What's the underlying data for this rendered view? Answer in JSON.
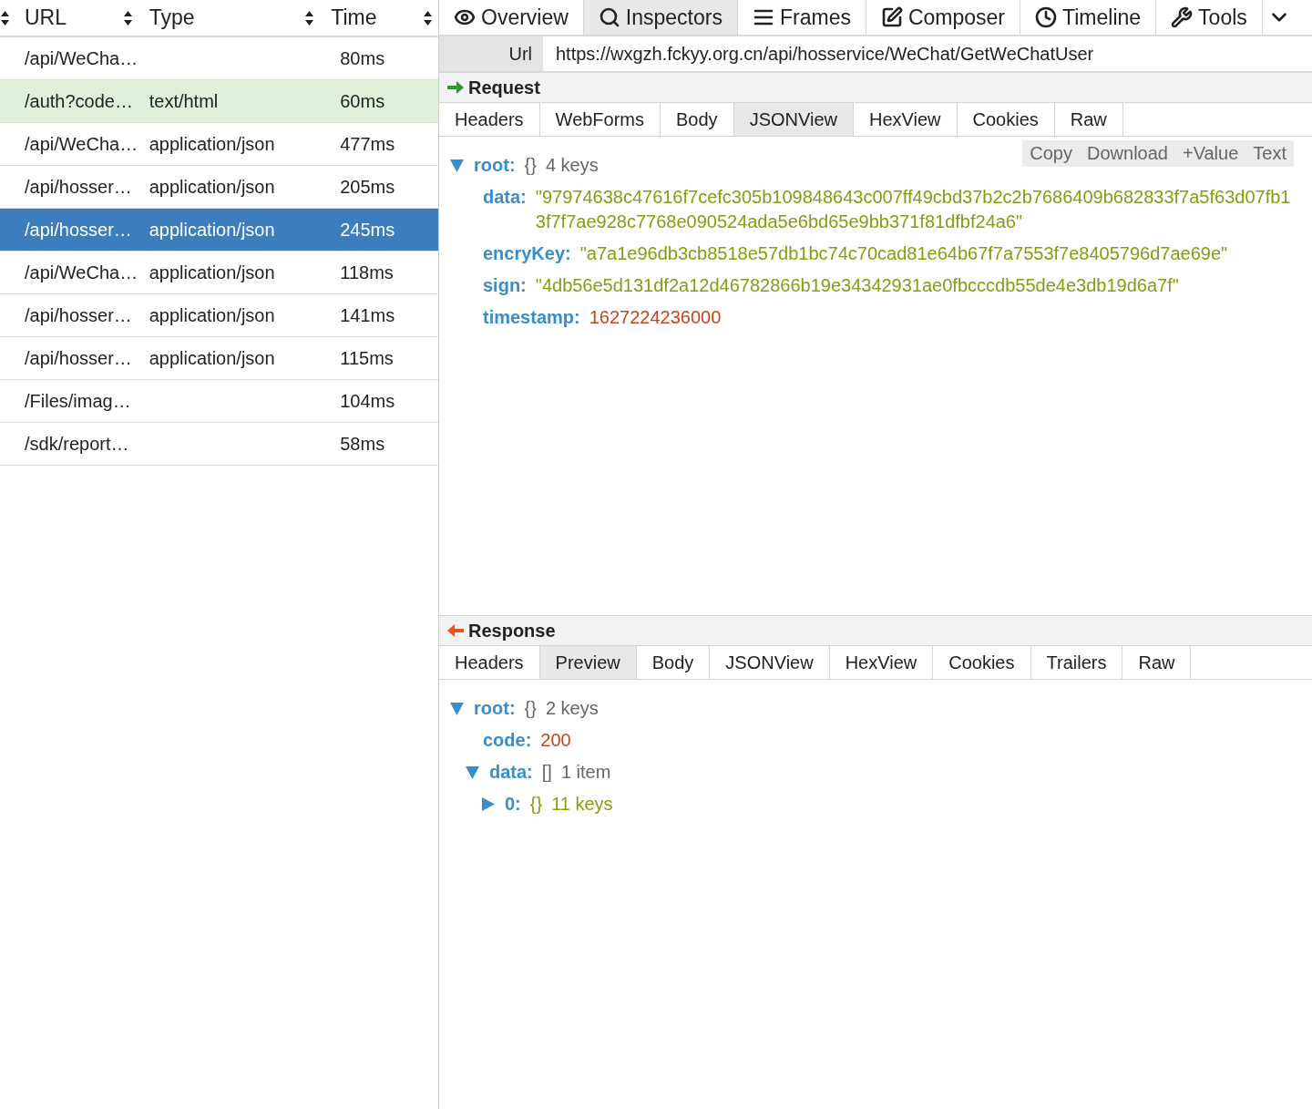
{
  "request_list": {
    "columns": [
      {
        "label": "URL"
      },
      {
        "label": "Type"
      },
      {
        "label": "Time"
      }
    ],
    "rows": [
      {
        "url": "/api/WeCha…",
        "time": "80ms",
        "selected": false,
        "highlighted": false
      },
      {
        "url": "/auth?code…",
        "type": "text/html",
        "time": "60ms",
        "selected": false,
        "highlighted": true
      },
      {
        "url": "/api/WeCha…",
        "type": "application/json",
        "time": "477ms",
        "selected": false,
        "highlighted": false
      },
      {
        "url": "/api/hosser…",
        "type": "application/json",
        "time": "205ms",
        "selected": false,
        "highlighted": false
      },
      {
        "url": "/api/hosser…",
        "type": "application/json",
        "time": "245ms",
        "selected": true,
        "highlighted": false
      },
      {
        "url": "/api/WeCha…",
        "type": "application/json",
        "time": "118ms",
        "selected": false,
        "highlighted": false
      },
      {
        "url": "/api/hosser…",
        "type": "application/json",
        "time": "141ms",
        "selected": false,
        "highlighted": false
      },
      {
        "url": "/api/hosser…",
        "type": "application/json",
        "time": "115ms",
        "selected": false,
        "highlighted": false
      },
      {
        "url": "/Files/imag…",
        "time": "104ms",
        "selected": false,
        "highlighted": false
      },
      {
        "url": "/sdk/report…",
        "time": "58ms",
        "selected": false,
        "highlighted": false
      }
    ]
  },
  "tool_tabs": [
    {
      "label": "Overview",
      "selected": false
    },
    {
      "label": "Inspectors",
      "selected": true
    },
    {
      "label": "Frames",
      "selected": false
    },
    {
      "label": "Composer",
      "selected": false
    },
    {
      "label": "Timeline",
      "selected": false
    },
    {
      "label": "Tools",
      "selected": false
    }
  ],
  "url_bar": {
    "label": "Url",
    "value": "https://wxgzh.fckyy.org.cn/api/hosservice/WeChat/GetWeChatUser"
  },
  "request": {
    "title": "Request",
    "tabs": [
      {
        "label": "Headers",
        "selected": false
      },
      {
        "label": "WebForms",
        "selected": false
      },
      {
        "label": "Body",
        "selected": false
      },
      {
        "label": "JSONView",
        "selected": true
      },
      {
        "label": "HexView",
        "selected": false
      },
      {
        "label": "Cookies",
        "selected": false
      },
      {
        "label": "Raw",
        "selected": false
      }
    ],
    "actions": [
      "Copy",
      "Download",
      "+Value",
      "Text"
    ],
    "tree": {
      "key": "root:",
      "expanded": true,
      "brace": "{}",
      "summary": "4 keys",
      "children": [
        {
          "key": "data:",
          "kind": "string",
          "value": "\"97974638c47616f7cefc305b109848643c007ff49cbd37b2c2b7686409b682833f7a5f63d07fb13f7f7ae928c7768e090524ada5e6bd65e9bb371f81dfbf24a6\""
        },
        {
          "key": "encryKey:",
          "kind": "string",
          "value": "\"a7a1e96db3cb8518e57db1bc74c70cad81e64b67f7a7553f7e8405796d7ae69e\""
        },
        {
          "key": "sign:",
          "kind": "string",
          "value": "\"4db56e5d131df2a12d46782866b19e34342931ae0fbcccdb55de4e3db19d6a7f\""
        },
        {
          "key": "timestamp:",
          "kind": "number",
          "value": "1627224236000"
        }
      ]
    }
  },
  "response": {
    "title": "Response",
    "tabs": [
      {
        "label": "Headers",
        "selected": false
      },
      {
        "label": "Preview",
        "selected": true
      },
      {
        "label": "Body",
        "selected": false
      },
      {
        "label": "JSONView",
        "selected": false
      },
      {
        "label": "HexView",
        "selected": false
      },
      {
        "label": "Cookies",
        "selected": false
      },
      {
        "label": "Trailers",
        "selected": false
      },
      {
        "label": "Raw",
        "selected": false
      }
    ],
    "tree": {
      "key": "root:",
      "expanded": true,
      "brace": "{}",
      "summary": "2 keys",
      "children": [
        {
          "key": "code:",
          "kind": "number",
          "value": "200"
        },
        {
          "key": "data:",
          "expanded": true,
          "brace": "[]",
          "summary": "1 item",
          "children": [
            {
              "key": "0:",
              "expanded": false,
              "brace": "{}",
              "summary": "11 keys"
            }
          ]
        }
      ]
    }
  }
}
